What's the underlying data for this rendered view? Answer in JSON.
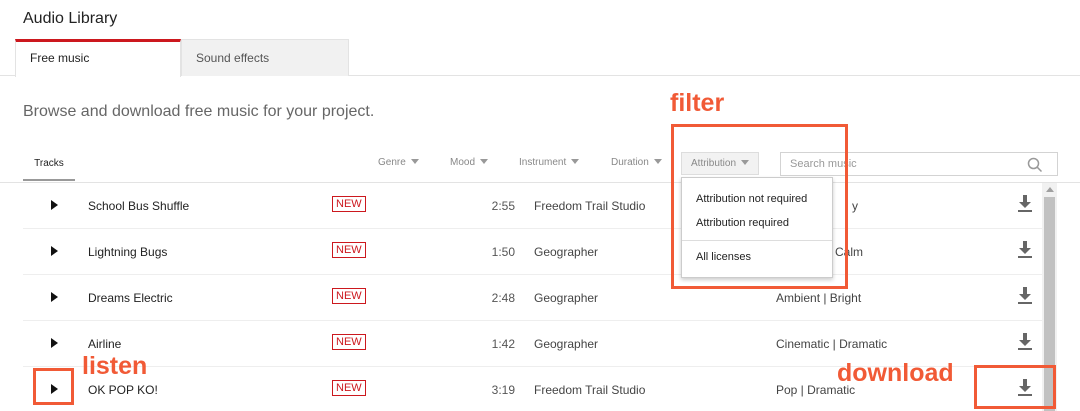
{
  "app": {
    "title": "Audio Library"
  },
  "tabs": [
    {
      "label": "Free music",
      "active": true
    },
    {
      "label": "Sound effects",
      "active": false
    }
  ],
  "intro": "Browse and download free music for your project.",
  "toolbar": {
    "tracks_label": "Tracks",
    "filters": [
      "Genre",
      "Mood",
      "Instrument",
      "Duration",
      "Attribution"
    ],
    "search_placeholder": "Search music"
  },
  "attribution_menu": {
    "options": [
      "Attribution not required",
      "Attribution required"
    ],
    "all_option": "All licenses"
  },
  "tracks": [
    {
      "title": "School Bus Shuffle",
      "badge": "NEW",
      "duration": "2:55",
      "artist": "Freedom Trail Studio",
      "genre": "y"
    },
    {
      "title": "Lightning Bugs",
      "badge": "NEW",
      "duration": "1:50",
      "artist": "Geographer",
      "genre": "Calm"
    },
    {
      "title": "Dreams Electric",
      "badge": "NEW",
      "duration": "2:48",
      "artist": "Geographer",
      "genre": "Ambient | Bright"
    },
    {
      "title": "Airline",
      "badge": "NEW",
      "duration": "1:42",
      "artist": "Geographer",
      "genre": "Cinematic | Dramatic"
    },
    {
      "title": "OK POP KO!",
      "badge": "NEW",
      "duration": "3:19",
      "artist": "Freedom Trail Studio",
      "genre": "Pop | Dramatic"
    }
  ],
  "annotations": {
    "filter": "filter",
    "listen": "listen",
    "download": "download"
  },
  "colors": {
    "accent_red": "#cc181e",
    "annotation": "#f15a36"
  }
}
